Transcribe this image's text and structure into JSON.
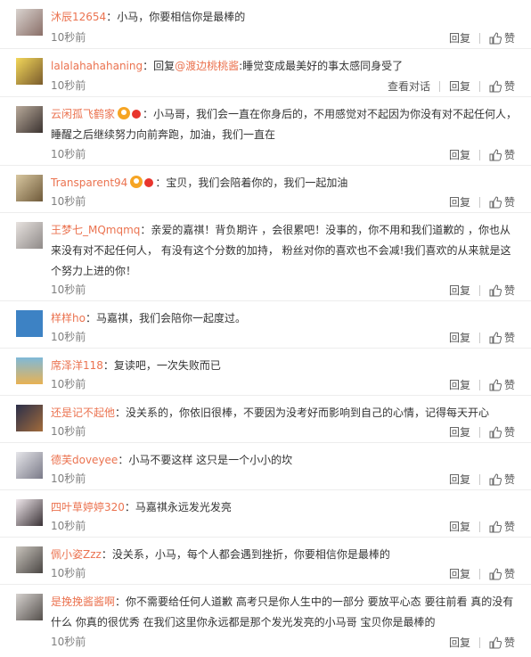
{
  "comments": [
    {
      "user": "沐辰12654",
      "text": "：小马，你要相信你是最棒的",
      "time": "10秒前",
      "reply": "回复",
      "like": "赞"
    },
    {
      "user": "lalalahahahaning",
      "text": "：回复",
      "mention": "@渡边桃桃酱",
      "text2": ":睡觉变成最美好的事太感同身受了",
      "time": "10秒前",
      "view_chat": "查看对话",
      "reply": "回复",
      "like": "赞"
    },
    {
      "user": "云闲孤飞鹤家",
      "text": "：小马哥，我们会一直在你身后的，不用感觉对不起因为你没有对不起任何人，睡醒之后继续努力向前奔跑，加油，我们一直在",
      "time": "10秒前",
      "reply": "回复",
      "like": "赞"
    },
    {
      "user": "Transparent94",
      "text": "：宝贝，我们会陪着你的，我们一起加油",
      "time": "10秒前",
      "reply": "回复",
      "like": "赞"
    },
    {
      "user": "王梦七_MQmqmq",
      "text": "：亲爱的嘉祺！背负期许 ，会很累吧！没事的，你不用和我们道歉的 ，你也从来没有对不起任何人， 有没有这个分数的加持， 粉丝对你的喜欢也不会减!我们喜欢的从来就是这个努力上进的你！",
      "time": "10秒前",
      "reply": "回复",
      "like": "赞"
    },
    {
      "user": "样样ho",
      "text": "：马嘉祺，我们会陪你一起度过。",
      "time": "10秒前",
      "reply": "回复",
      "like": "赞"
    },
    {
      "user": "席泽洋118",
      "text": "：复读吧，一次失败而已",
      "time": "10秒前",
      "reply": "回复",
      "like": "赞"
    },
    {
      "user": "还是记不起他",
      "text": "：没关系的，你依旧很棒，不要因为没考好而影响到自己的心情，记得每天开心",
      "time": "10秒前",
      "reply": "回复",
      "like": "赞"
    },
    {
      "user": "德芙doveyee",
      "text": "：小马不要这样 这只是一个小小的坎",
      "time": "10秒前",
      "reply": "回复",
      "like": "赞"
    },
    {
      "user": "四叶草婷婷320",
      "text": "：马嘉祺永远发光发亮",
      "time": "10秒前",
      "reply": "回复",
      "like": "赞"
    },
    {
      "user": "佩小姿Zzz",
      "text": "：没关系，小马，每个人都会遇到挫折，你要相信你是最棒的",
      "time": "10秒前",
      "reply": "回复",
      "like": "赞"
    },
    {
      "user": "是挽挽酱酱啊",
      "text": "：你不需要给任何人道歉 高考只是你人生中的一部分 要放平心态 要往前看 真的没有什么 你真的很优秀 在我们这里你永远都是那个发光发亮的小马哥 宝贝你是最棒的",
      "time": "10秒前",
      "reply": "回复",
      "like": "赞"
    }
  ],
  "colors": {
    "username": "#eb7350",
    "text": "#333333",
    "time": "#808080",
    "divider": "#ededed"
  }
}
